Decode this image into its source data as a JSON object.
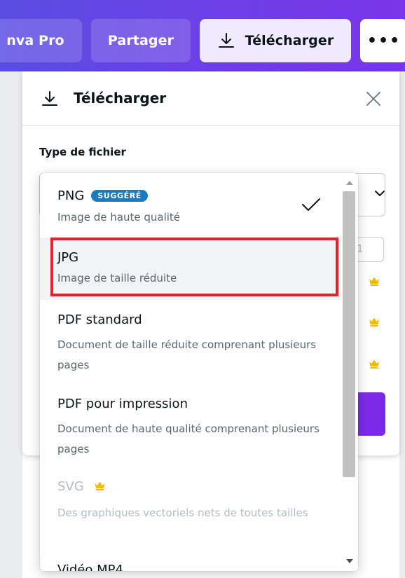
{
  "topbar": {
    "pro_label": "nva Pro",
    "share_label": "Partager",
    "download_label": "Télécharger",
    "more_label": "•••"
  },
  "panel": {
    "title": "Télécharger",
    "file_type_label": "Type de fichier",
    "small_input_value": "1"
  },
  "dropdown": {
    "items": [
      {
        "title": "PNG",
        "badge": "SUGGÉRÉ",
        "description": "Image de haute qualité",
        "selected": true
      },
      {
        "title": "JPG",
        "description": "Image de taille réduite"
      },
      {
        "title": "PDF standard",
        "description": "Document de taille réduite comprenant plusieurs pages"
      },
      {
        "title": "PDF pour impression",
        "description": "Document de haute qualité comprenant plusieurs pages"
      },
      {
        "title": "SVG",
        "description": "Des graphiques vectoriels nets de toutes tailles",
        "premium": true,
        "disabled": true
      },
      {
        "title": "Vidéo MP4"
      }
    ]
  },
  "icons": {
    "download": "download-icon",
    "close": "close-icon",
    "check": "check-icon",
    "crown": "crown-icon",
    "chevron": "chevron-down-icon"
  },
  "colors": {
    "brand_purple": "#7d2ae8",
    "badge_blue": "#1b7bbf",
    "highlight_red": "#e8202a",
    "crown_gold": "#f5b700"
  }
}
